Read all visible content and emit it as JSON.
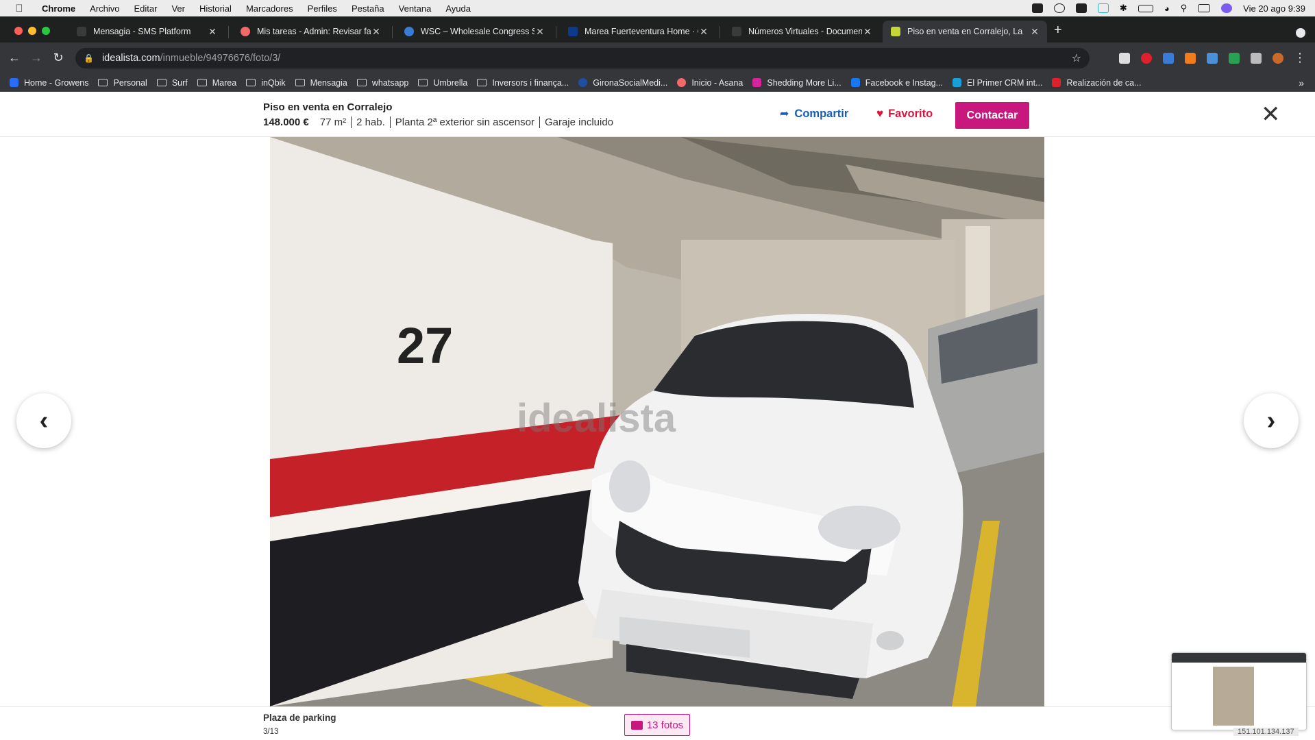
{
  "menubar": {
    "app": "Chrome",
    "items": [
      "Archivo",
      "Editar",
      "Ver",
      "Historial",
      "Marcadores",
      "Perfiles",
      "Pestaña",
      "Ventana",
      "Ayuda"
    ],
    "clock": "Vie 20 ago  9:39"
  },
  "tabs": [
    {
      "title": "Mensagia - SMS Platform",
      "favicon_color": "#3a3a3a"
    },
    {
      "title": "Mis tareas - Admin: Revisar fac",
      "favicon_color": "#f06a6a"
    },
    {
      "title": "WSC – Wholesale Congress Se",
      "favicon_color": "#3a7bd5"
    },
    {
      "title": "Marea Fuerteventura Home · C",
      "favicon_color": "#0d3b8c"
    },
    {
      "title": "Números Virtuales - Document",
      "favicon_color": "#3a3a3a"
    },
    {
      "title": "Piso en venta en Corralejo, La",
      "favicon_color": "#c5d63b",
      "active": true
    }
  ],
  "address_bar": {
    "host": "idealista.com",
    "path": "/inmueble/94976676/foto/3/"
  },
  "bookmarks": [
    {
      "label": "Home - Growens",
      "type": "favicon",
      "color": "#2a6df4"
    },
    {
      "label": "Personal",
      "type": "folder"
    },
    {
      "label": "Surf",
      "type": "folder"
    },
    {
      "label": "Marea",
      "type": "folder"
    },
    {
      "label": "inQbik",
      "type": "folder"
    },
    {
      "label": "Mensagia",
      "type": "folder"
    },
    {
      "label": "whatsapp",
      "type": "folder"
    },
    {
      "label": "Umbrella",
      "type": "folder"
    },
    {
      "label": "Inversors i finança...",
      "type": "folder"
    },
    {
      "label": "GironaSocialMedi...",
      "type": "favicon",
      "color": "#1e4fa0"
    },
    {
      "label": "Inicio - Asana",
      "type": "favicon",
      "color": "#f06a6a"
    },
    {
      "label": "Shedding More Li...",
      "type": "favicon",
      "color": "#d6249f"
    },
    {
      "label": "Facebook e Instag...",
      "type": "favicon",
      "color": "#1877f2"
    },
    {
      "label": "El Primer CRM int...",
      "type": "favicon",
      "color": "#1aa0d8"
    },
    {
      "label": "Realización de ca...",
      "type": "favicon",
      "color": "#e0202a"
    }
  ],
  "listing": {
    "title": "Piso en venta en Corralejo",
    "price": "148.000 €",
    "features": [
      "77 m²",
      "2 hab.",
      "Planta 2ª exterior sin ascensor",
      "Garaje incluido"
    ],
    "share_label": "Compartir",
    "favorite_label": "Favorito",
    "contact_label": "Contactar"
  },
  "photo": {
    "parking_number": "27",
    "watermark": "idealista",
    "caption": "Plaza de parking",
    "position": "3/13",
    "photos_button": "13 fotos"
  },
  "thumbnail": {
    "ip_text": "151.101.134.137"
  },
  "colors": {
    "brand": "#c8177d",
    "link_blue": "#1a5bb4",
    "favorite_red": "#d6163f"
  }
}
